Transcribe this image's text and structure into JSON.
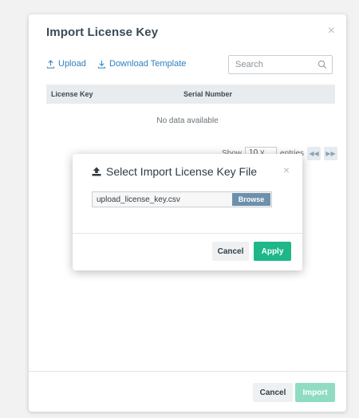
{
  "modal": {
    "title": "Import License Key",
    "close_icon": "×",
    "upload_label": "Upload",
    "download_template_label": "Download Template",
    "search_placeholder": "Search",
    "columns": [
      "License Key",
      "Serial Number"
    ],
    "empty_text": "No data available",
    "pager": {
      "show_label": "Show",
      "page_size": "10",
      "entries_label": "entries"
    },
    "cancel_label": "Cancel",
    "import_label": "Import"
  },
  "dialog": {
    "title": "Select Import License Key File",
    "close_icon": "×",
    "file_name": "upload_license_key.csv",
    "browse_label": "Browse",
    "cancel_label": "Cancel",
    "apply_label": "Apply"
  },
  "colors": {
    "accent": "#1eb787",
    "link": "#2d7fc1",
    "browse": "#6d90ac"
  },
  "icons": {
    "upload": "upload-icon",
    "download": "download-icon",
    "search": "search-icon",
    "file_upload": "upload-file-icon"
  }
}
